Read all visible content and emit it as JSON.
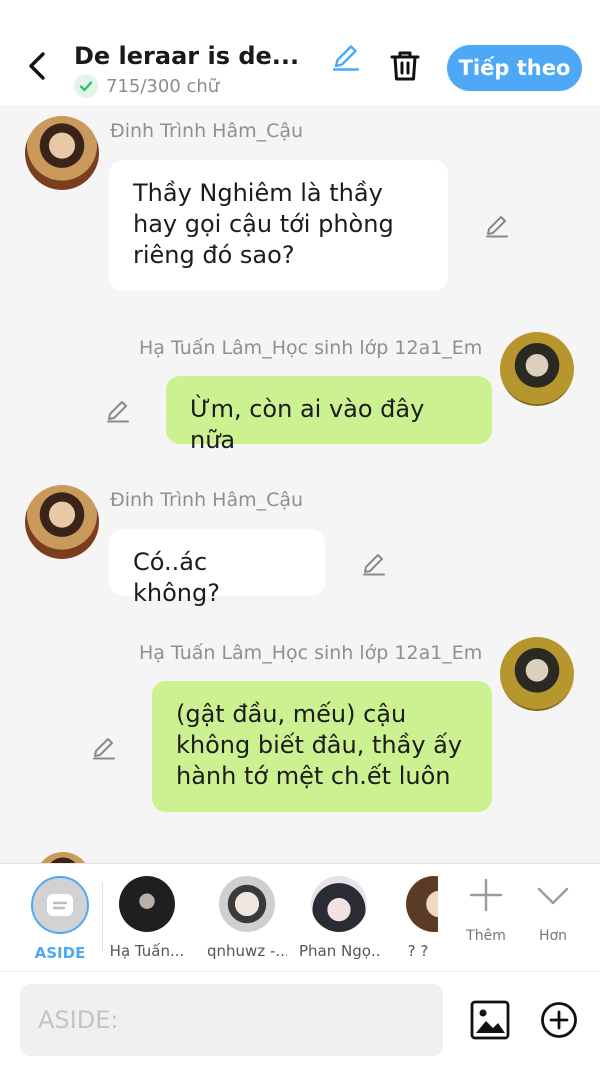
{
  "header": {
    "title": "De leraar is de...",
    "word_count": "715/300 chữ",
    "next_label": "Tiếp theo"
  },
  "messages": [
    {
      "sender": "Đinh Trình Hâm_Cậu",
      "side": "left",
      "text": "Thầy Nghiêm là thầy hay gọi cậu tới phòng riêng đó sao?"
    },
    {
      "sender": "Hạ Tuấn Lâm_Học sinh lớp 12a1_Em",
      "side": "right",
      "text": "Ừm, còn ai vào đây nữa"
    },
    {
      "sender": "Đinh Trình Hâm_Cậu",
      "side": "left",
      "text": "Có..ác không?"
    },
    {
      "sender": "Hạ Tuấn Lâm_Học sinh lớp 12a1_Em",
      "side": "right",
      "text": "(gật đầu, mếu) cậu không biết đâu, thầy ấy hành tớ mệt ch.ết luôn"
    }
  ],
  "characters": [
    {
      "name": "ASIDE",
      "selected": true
    },
    {
      "name": "Hạ Tuấn..."
    },
    {
      "name": "qnhuwz -..."
    },
    {
      "name": "Phan Ngọ..."
    },
    {
      "name": "? ?"
    }
  ],
  "more": {
    "add_label": "Thêm",
    "more_label": "Hơn"
  },
  "composer": {
    "placeholder": "ASIDE:"
  },
  "colors": {
    "accent": "#4fa8f5",
    "bubble_green": "#ccf191",
    "bubble_white": "#ffffff",
    "check_green": "#34c06a"
  }
}
